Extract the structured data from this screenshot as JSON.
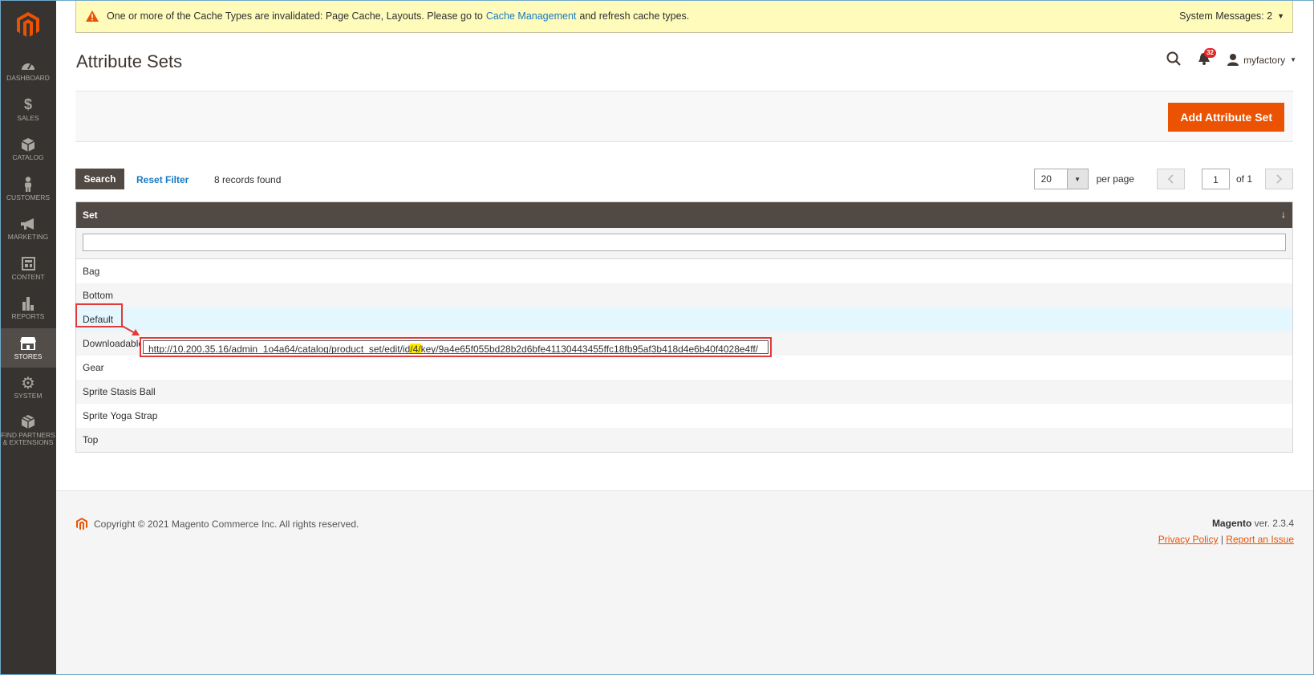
{
  "system_message": {
    "text_before": "One or more of the Cache Types are invalidated: Page Cache, Layouts. Please go to",
    "link": "Cache Management",
    "text_after": "and refresh cache types.",
    "system_messages_label": "System Messages: 2"
  },
  "sidebar": {
    "items": [
      {
        "label": "DASHBOARD",
        "icon": "dashboard-icon"
      },
      {
        "label": "SALES",
        "icon": "dollar-icon"
      },
      {
        "label": "CATALOG",
        "icon": "cube-icon"
      },
      {
        "label": "CUSTOMERS",
        "icon": "person-icon"
      },
      {
        "label": "MARKETING",
        "icon": "megaphone-icon"
      },
      {
        "label": "CONTENT",
        "icon": "layout-icon"
      },
      {
        "label": "REPORTS",
        "icon": "bar-chart-icon"
      },
      {
        "label": "STORES",
        "icon": "store-icon",
        "active": true
      },
      {
        "label": "SYSTEM",
        "icon": "gear-icon"
      },
      {
        "label": "FIND PARTNERS & EXTENSIONS",
        "icon": "boxes-icon"
      }
    ]
  },
  "header": {
    "title": "Attribute Sets",
    "notifications_count": "32",
    "username": "myfactory"
  },
  "actions": {
    "add_button": "Add Attribute Set"
  },
  "grid": {
    "search_button": "Search",
    "reset_filter": "Reset Filter",
    "records_found": "8 records found",
    "per_page_value": "20",
    "per_page_label": "per page",
    "page_current": "1",
    "page_of": "of 1",
    "column_header": "Set",
    "sort_glyph": "↓",
    "rows": [
      "Bag",
      "Bottom",
      "Default",
      "Downloadable",
      "Gear",
      "Sprite Stasis Ball",
      "Sprite Yoga Strap",
      "Top"
    ]
  },
  "annotation": {
    "url_before": "http://10.200.35.16/admin_1o4a64/catalog/product_set/edit/id",
    "url_highlight": "/4/",
    "url_after": "key/9a4e65f055bd28b2d6bfe41130443455ffc18fb95af3b418d4e6b40f4028e4ff/"
  },
  "footer": {
    "copyright": "Copyright © 2021 Magento Commerce Inc. All rights reserved.",
    "brand": "Magento",
    "version": "ver. 2.3.4",
    "privacy": "Privacy Policy",
    "separator": "|",
    "report": "Report an Issue"
  },
  "colors": {
    "accent": "#eb5202",
    "sidebar": "#373330",
    "grid_header": "#514943",
    "link": "#1979c3",
    "annotation": "#e03a3a"
  }
}
